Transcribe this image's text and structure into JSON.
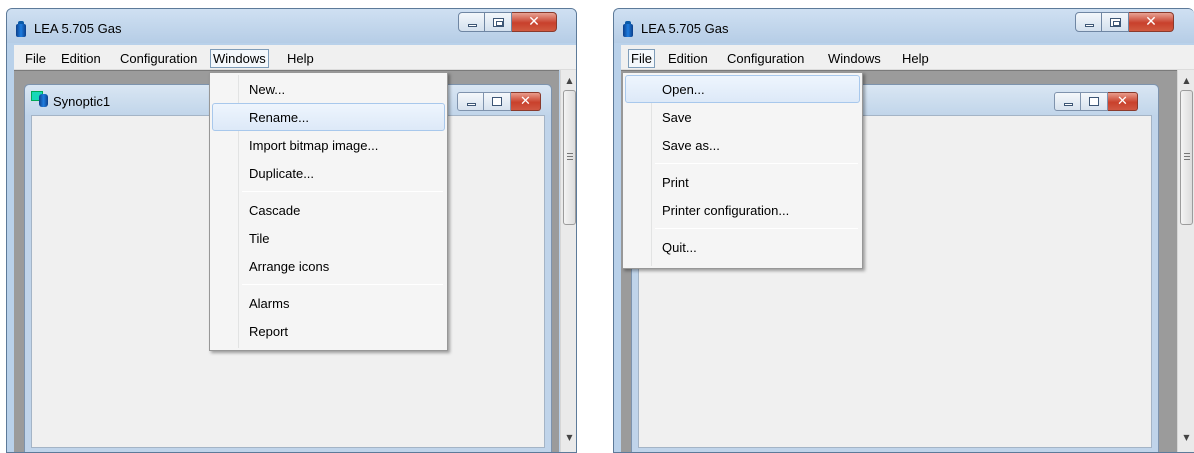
{
  "left_window": {
    "title": "LEA 5.705 Gas",
    "menu": [
      "File",
      "Edition",
      "Configuration",
      "Windows",
      "Help"
    ],
    "open_menu": "Windows",
    "mdi_child_title": "Synoptic1",
    "dropdown": {
      "items": [
        {
          "label": "New...",
          "highlighted": false
        },
        {
          "label": "Rename...",
          "highlighted": true
        },
        {
          "label": "Import bitmap image...",
          "highlighted": false
        },
        {
          "label": "Duplicate...",
          "highlighted": false
        },
        {
          "separator": true
        },
        {
          "label": "Cascade",
          "highlighted": false
        },
        {
          "label": "Tile",
          "highlighted": false
        },
        {
          "label": "Arrange icons",
          "highlighted": false
        },
        {
          "separator": true
        },
        {
          "label": "Alarms",
          "highlighted": false
        },
        {
          "label": "Report",
          "highlighted": false
        }
      ]
    }
  },
  "right_window": {
    "title": "LEA 5.705 Gas",
    "menu": [
      "File",
      "Edition",
      "Configuration",
      "Windows",
      "Help"
    ],
    "open_menu": "File",
    "dropdown": {
      "items": [
        {
          "label": "Open...",
          "highlighted": true
        },
        {
          "label": "Save",
          "highlighted": false
        },
        {
          "label": "Save as...",
          "highlighted": false
        },
        {
          "separator": true
        },
        {
          "label": "Print",
          "highlighted": false
        },
        {
          "label": "Printer configuration...",
          "highlighted": false
        },
        {
          "separator": true
        },
        {
          "label": "Quit...",
          "highlighted": false
        }
      ]
    }
  },
  "glyphs": {
    "close": "✕",
    "scroll_up": "▲",
    "scroll_down": "▼"
  },
  "colors": {
    "highlight_border": "#a8c8ec",
    "close_button": "#c8402c",
    "title_bar": "#b9d1ea"
  }
}
